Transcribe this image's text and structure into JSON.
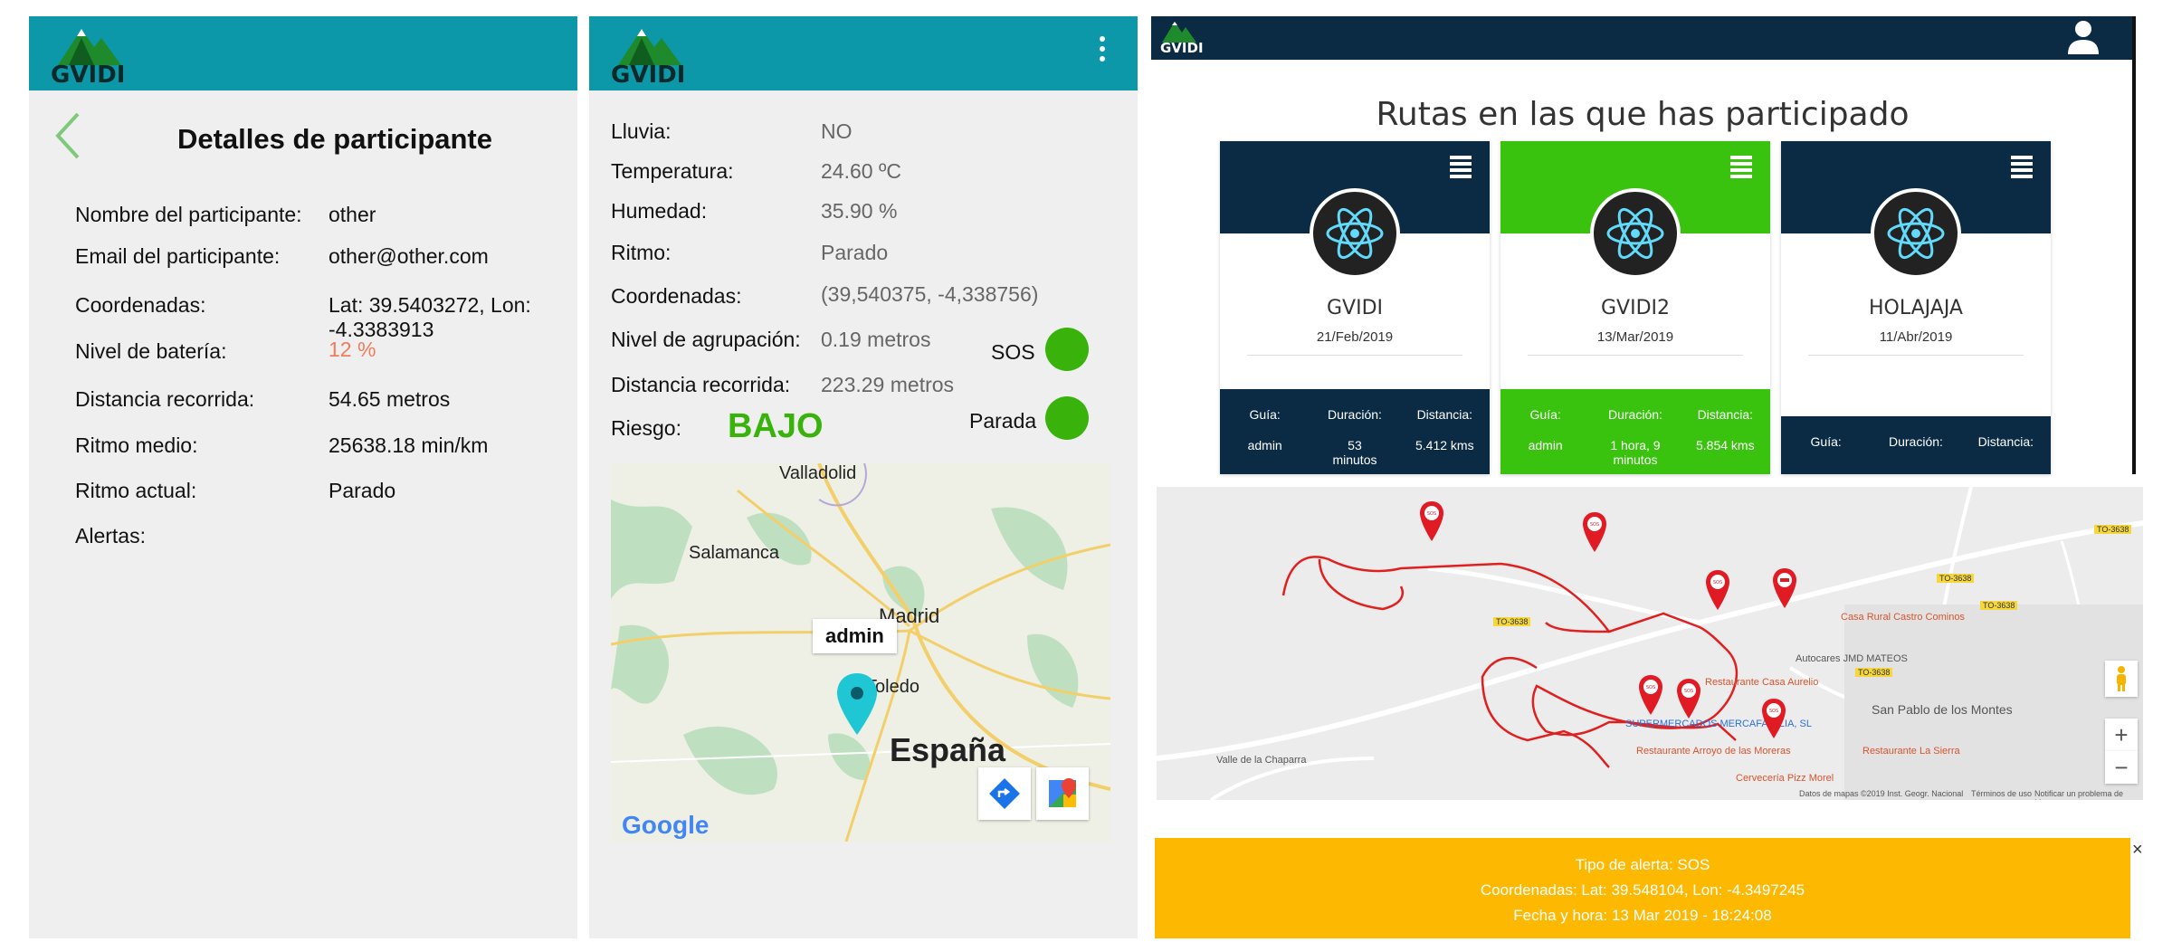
{
  "brand": {
    "logo_text": "GVIDI",
    "teal": "#0d98a9",
    "navy": "#0b2b45",
    "green": "#39b30c",
    "alert_yellow": "#fdb802",
    "battery_color": "#f07c5a"
  },
  "participant": {
    "title": "Detalles de participante",
    "icons": [
      "back-arrow-icon"
    ],
    "fields": {
      "name_label": "Nombre del participante:",
      "name_value": "other",
      "email_label": "Email del participante:",
      "email_value": "other@other.com",
      "coords_label": "Coordenadas:",
      "coords_line1": "Lat: 39.5403272, Lon:",
      "coords_line2": "-4.3383913",
      "battery_label": "Nivel de batería:",
      "battery_value": "12 %",
      "distance_label": "Distancia recorrida:",
      "distance_value": "54.65 metros",
      "avg_pace_label": "Ritmo medio:",
      "avg_pace_value": "25638.18 min/km",
      "cur_pace_label": "Ritmo actual:",
      "cur_pace_value": "Parado",
      "alerts_label": "Alertas:"
    }
  },
  "route_status": {
    "icons": [
      "kebab-menu-icon"
    ],
    "rain_label": "Lluvia:",
    "rain_value": "NO",
    "temp_label": "Temperatura:",
    "temp_value": "24.60 ºC",
    "humidity_label": "Humedad:",
    "humidity_value": "35.90 %",
    "pace_label": "Ritmo:",
    "pace_value": "Parado",
    "coords_label": "Coordenadas:",
    "coords_value": "(39,540375, -4,338756)",
    "group_label": "Nivel de agrupación:",
    "group_value": "0.19 metros",
    "distance_label": "Distancia recorrida:",
    "distance_value": "223.29 metros",
    "risk_label": "Riesgo:",
    "risk_value": "BAJO",
    "sos_label": "SOS",
    "stopped_label": "Parada",
    "map": {
      "cities": [
        "Valladolid",
        "Salamanca",
        "Madrid",
        "Toledo"
      ],
      "country": "España",
      "marker_label": "admin",
      "google": "Google"
    }
  },
  "web": {
    "title": "Rutas en las que has participado",
    "icons": [
      "user-icon",
      "hamburger-icon",
      "react-logo-icon",
      "map-pin-icon",
      "zoom-in-icon",
      "zoom-out-icon",
      "pegman-icon",
      "close-icon"
    ],
    "cards": [
      {
        "name": "GVIDI",
        "date": "21/Feb/2019",
        "head_color": "#0b2b45",
        "foot_color": "#0b2b45",
        "labels": [
          "Guía:",
          "Duración:",
          "Distancia:"
        ],
        "guide": "admin",
        "duration_1": "53",
        "duration_2": "minutos",
        "distance": "5.412 kms"
      },
      {
        "name": "GVIDI2",
        "date": "13/Mar/2019",
        "head_color": "#39c20e",
        "foot_color": "#39c20e",
        "labels": [
          "Guía:",
          "Duración:",
          "Distancia:"
        ],
        "guide": "admin",
        "duration_1": "1 hora, 9",
        "duration_2": "minutos",
        "distance": "5.854 kms"
      },
      {
        "name": "HOLAJAJA",
        "date": "11/Abr/2019",
        "head_color": "#0b2b45",
        "foot_color": "#0b2b45",
        "labels": [
          "Guía:",
          "Duración:",
          "Distancia:"
        ]
      }
    ],
    "map": {
      "places": [
        "Casa Rural Castro Cominos",
        "Autocares JMD MATEOS",
        "Restaurante Casa Aurelio",
        "SUPERMERCADOS MERCAFAMILIA, SL",
        "Restaurante Arroyo de las Moreras",
        "Restaurante La Sierra",
        "Cervecería Pizz Morel",
        "San Pablo de los Montes",
        "Valle de la Chaparra"
      ],
      "roads": [
        "TO-3638",
        "TO-3638",
        "TO-3638",
        "TO-3638",
        "TO-3638"
      ],
      "pin_label": "SOS",
      "footer": [
        "Datos de mapas ©2019 Inst. Geogr. Nacional",
        "Términos de uso",
        "Notificar un problema de Maps"
      ],
      "zoom_in": "+",
      "zoom_out": "−"
    },
    "alert": {
      "line1": "Tipo de alerta: SOS",
      "line2": "Coordenadas: Lat: 39.548104, Lon: -4.3497245",
      "line3": "Fecha y hora: 13 Mar 2019 - 18:24:08",
      "close": "×"
    }
  }
}
